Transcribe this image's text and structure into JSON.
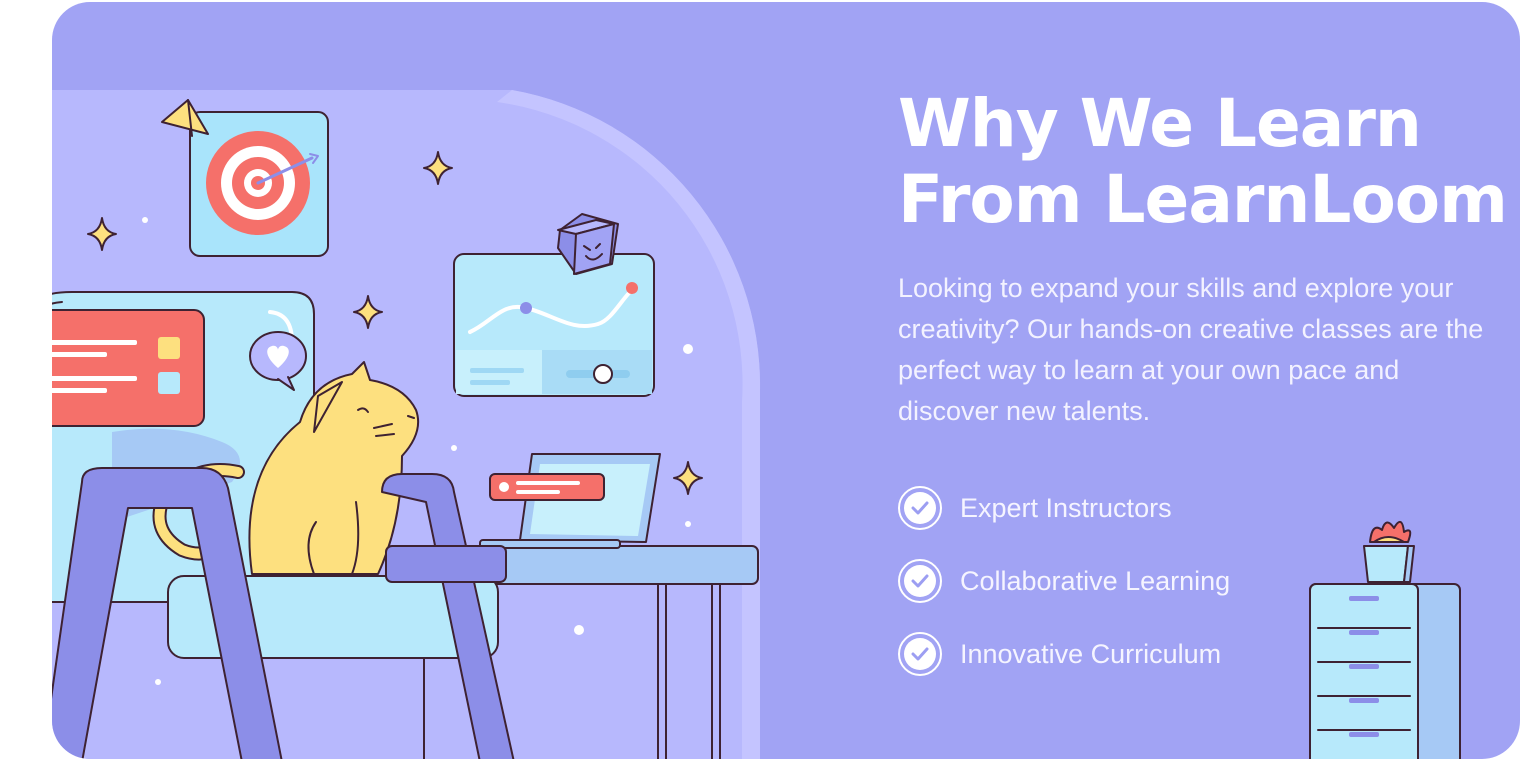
{
  "section": {
    "title_line1": "Why We Learn",
    "title_line2": "From LearnLoom",
    "description": "Looking to expand your skills and explore your creativity? Our hands-on creative classes are the perfect way to learn at your own pace and discover new talents."
  },
  "features": [
    {
      "label": "Expert Instructors",
      "icon": "check-circle-icon"
    },
    {
      "label": "Collaborative Learning",
      "icon": "check-circle-icon"
    },
    {
      "label": "Innovative Curriculum",
      "icon": "check-circle-icon"
    }
  ],
  "colors": {
    "card_background": "#a1a3f4",
    "illustration_background": "#b7b8fd",
    "text": "#ffffff",
    "check_accent": "#9c9ef2",
    "cat": "#fde07f",
    "chair": "#b7e9fb",
    "note_card": "#f5706a"
  },
  "illustration": {
    "icons": [
      "target-icon",
      "sparkle-icon",
      "heart-bubble-icon",
      "chart-card-icon",
      "laptop-icon",
      "cat-icon",
      "plant-icon",
      "drawer-cabinet-icon"
    ]
  }
}
